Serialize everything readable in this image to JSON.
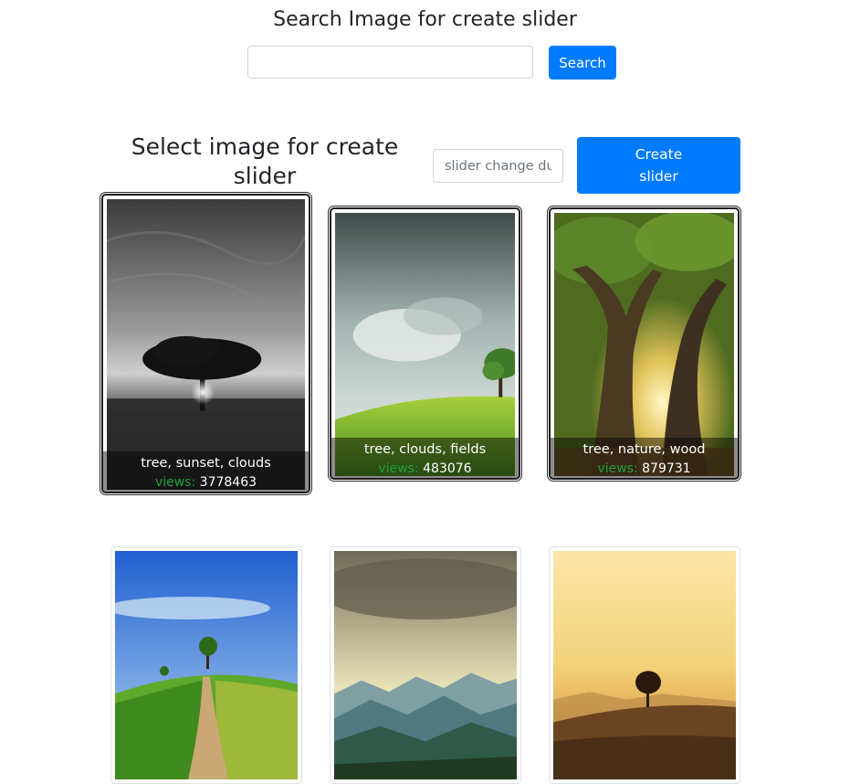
{
  "header": {
    "title": "Search Image for create slider",
    "search_value": "",
    "search_button": "Search"
  },
  "selection": {
    "title": "Select image for create slider",
    "duration_placeholder": "slider change du",
    "create_button": "Create slider"
  },
  "images": [
    {
      "tags": "tree, sunset, clouds",
      "views_label": "views:",
      "views": "3778463",
      "selected": true
    },
    {
      "tags": "tree, clouds, fields",
      "views_label": "views:",
      "views": "483076",
      "selected": true
    },
    {
      "tags": "tree, nature, wood",
      "views_label": "views:",
      "views": "879731",
      "selected": true
    },
    {
      "tags": "",
      "views_label": "",
      "views": "",
      "selected": false
    },
    {
      "tags": "",
      "views_label": "",
      "views": "",
      "selected": false
    },
    {
      "tags": "",
      "views_label": "",
      "views": "",
      "selected": false
    }
  ],
  "colors": {
    "primary": "#007bff",
    "views_label": "#1aa33a"
  }
}
